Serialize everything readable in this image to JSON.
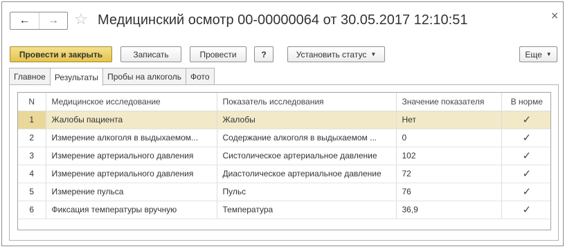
{
  "title": "Медицинский осмотр 00-00000064 от 30.05.2017 12:10:51",
  "nav": {
    "back": "←",
    "forward": "→"
  },
  "toolbar": {
    "post_and_close": "Провести и закрыть",
    "write": "Записать",
    "post": "Провести",
    "help": "?",
    "set_status": "Установить статус",
    "more": "Еще"
  },
  "tabs": [
    {
      "label": "Главное"
    },
    {
      "label": "Результаты",
      "active": true
    },
    {
      "label": "Пробы на алкоголь"
    },
    {
      "label": "Фото"
    }
  ],
  "table": {
    "headers": {
      "n": "N",
      "study": "Медицинское исследование",
      "indicator": "Показатель исследования",
      "value": "Значение показателя",
      "normal": "В норме"
    },
    "rows": [
      {
        "n": "1",
        "study": "Жалобы пациента",
        "indicator": "Жалобы",
        "value": "Нет",
        "normal": "✓"
      },
      {
        "n": "2",
        "study": "Измерение алкоголя в выдыхаемом...",
        "indicator": "Содержание алкоголя в выдыхаемом ...",
        "value": "0",
        "normal": "✓"
      },
      {
        "n": "3",
        "study": "Измерение артериального давления",
        "indicator": "Систолическое артериальное давление",
        "value": "102",
        "normal": "✓"
      },
      {
        "n": "4",
        "study": "Измерение артериального давления",
        "indicator": "Диастолическое артериальное давление",
        "value": "72",
        "normal": "✓"
      },
      {
        "n": "5",
        "study": "Измерение пульса",
        "indicator": "Пульс",
        "value": "76",
        "normal": "✓"
      },
      {
        "n": "6",
        "study": "Фиксация температуры вручную",
        "indicator": "Температура",
        "value": "36,9",
        "normal": "✓"
      }
    ]
  },
  "colors": {
    "primary_button": "#e6c44e",
    "selected_row": "#f2e9c8"
  }
}
